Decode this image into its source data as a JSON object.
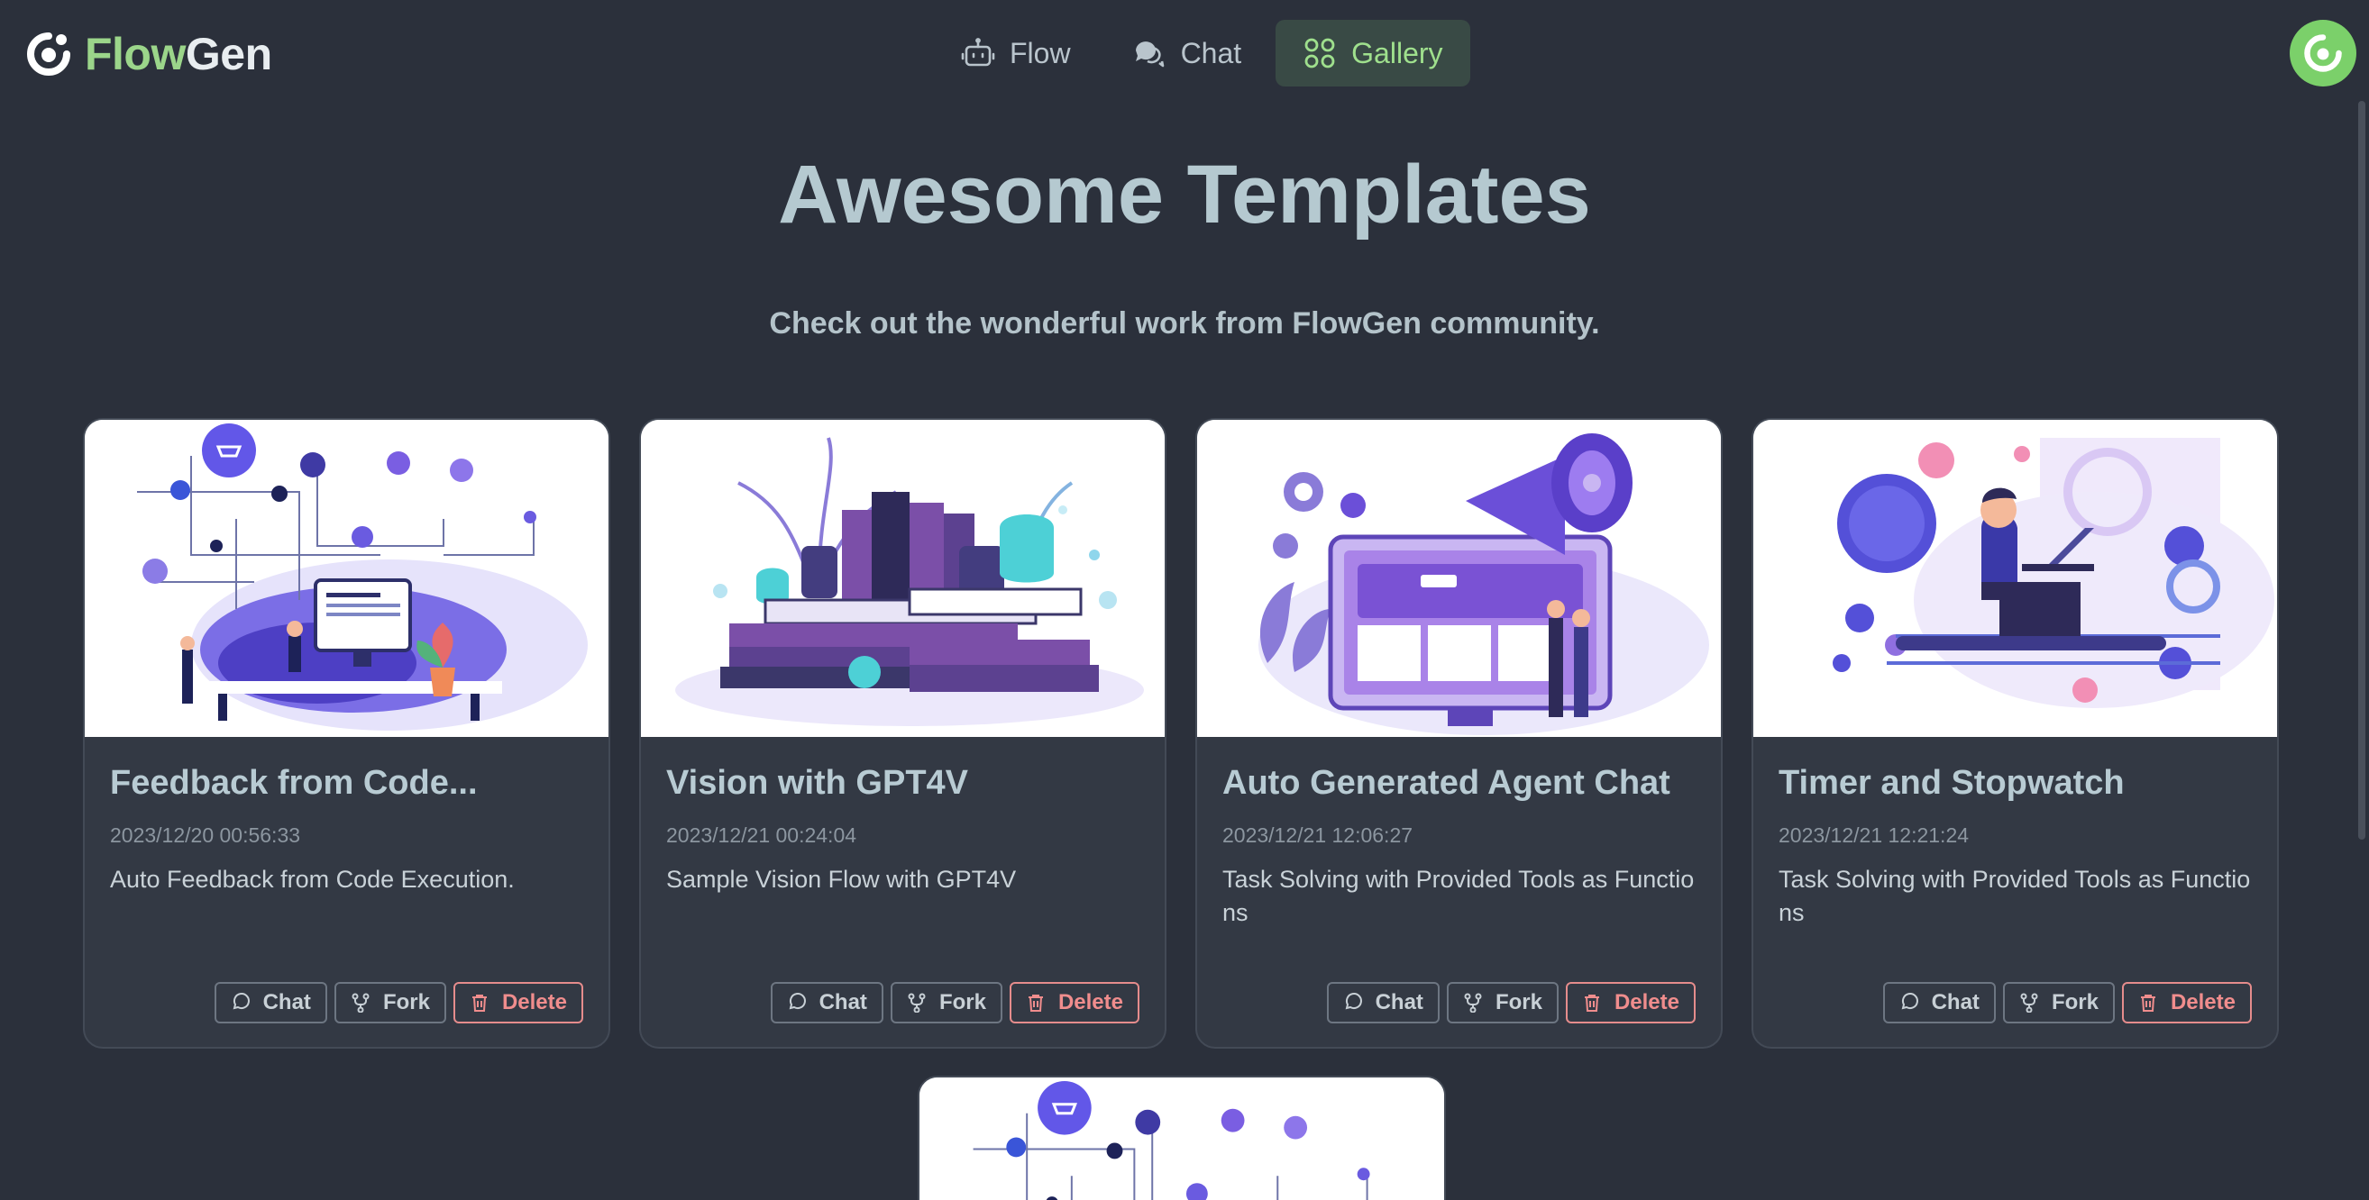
{
  "app": {
    "brand_part1": "Flow",
    "brand_part2": "Gen",
    "brand_color_accent": "#9bd58a",
    "logo_icon": "flowgen-logo-icon",
    "avatar_icon": "flowgen-avatar-icon"
  },
  "nav": {
    "tabs": [
      {
        "label": "Flow",
        "icon": "robot-icon",
        "active": false
      },
      {
        "label": "Chat",
        "icon": "chat-bubbles-icon",
        "active": false
      },
      {
        "label": "Gallery",
        "icon": "grid-icon",
        "active": true
      }
    ]
  },
  "hero": {
    "title": "Awesome Templates",
    "subtitle": "Check out the wonderful work from FlowGen community."
  },
  "templates": [
    {
      "title": "Feedback from Code...",
      "date": "2023/12/20 00:56:33",
      "description": "Auto Feedback from Code Execution.",
      "thumbnail": "network-illustration"
    },
    {
      "title": "Vision with GPT4V",
      "date": "2023/12/21 00:24:04",
      "description": "Sample Vision Flow with GPT4V",
      "thumbnail": "books-illustration"
    },
    {
      "title": "Auto Generated Agent Chat",
      "date": "2023/12/21 12:06:27",
      "description": "Task Solving with Provided Tools as Functions",
      "thumbnail": "megaphone-illustration"
    },
    {
      "title": "Timer and Stopwatch",
      "date": "2023/12/21 12:21:24",
      "description": "Task Solving with Provided Tools as Functions",
      "thumbnail": "laptop-person-illustration"
    }
  ],
  "card_actions": {
    "chat_label": "Chat",
    "fork_label": "Fork",
    "delete_label": "Delete",
    "chat_icon": "chat-icon",
    "fork_icon": "fork-icon",
    "delete_icon": "trash-icon",
    "delete_color": "#f08d8d"
  }
}
